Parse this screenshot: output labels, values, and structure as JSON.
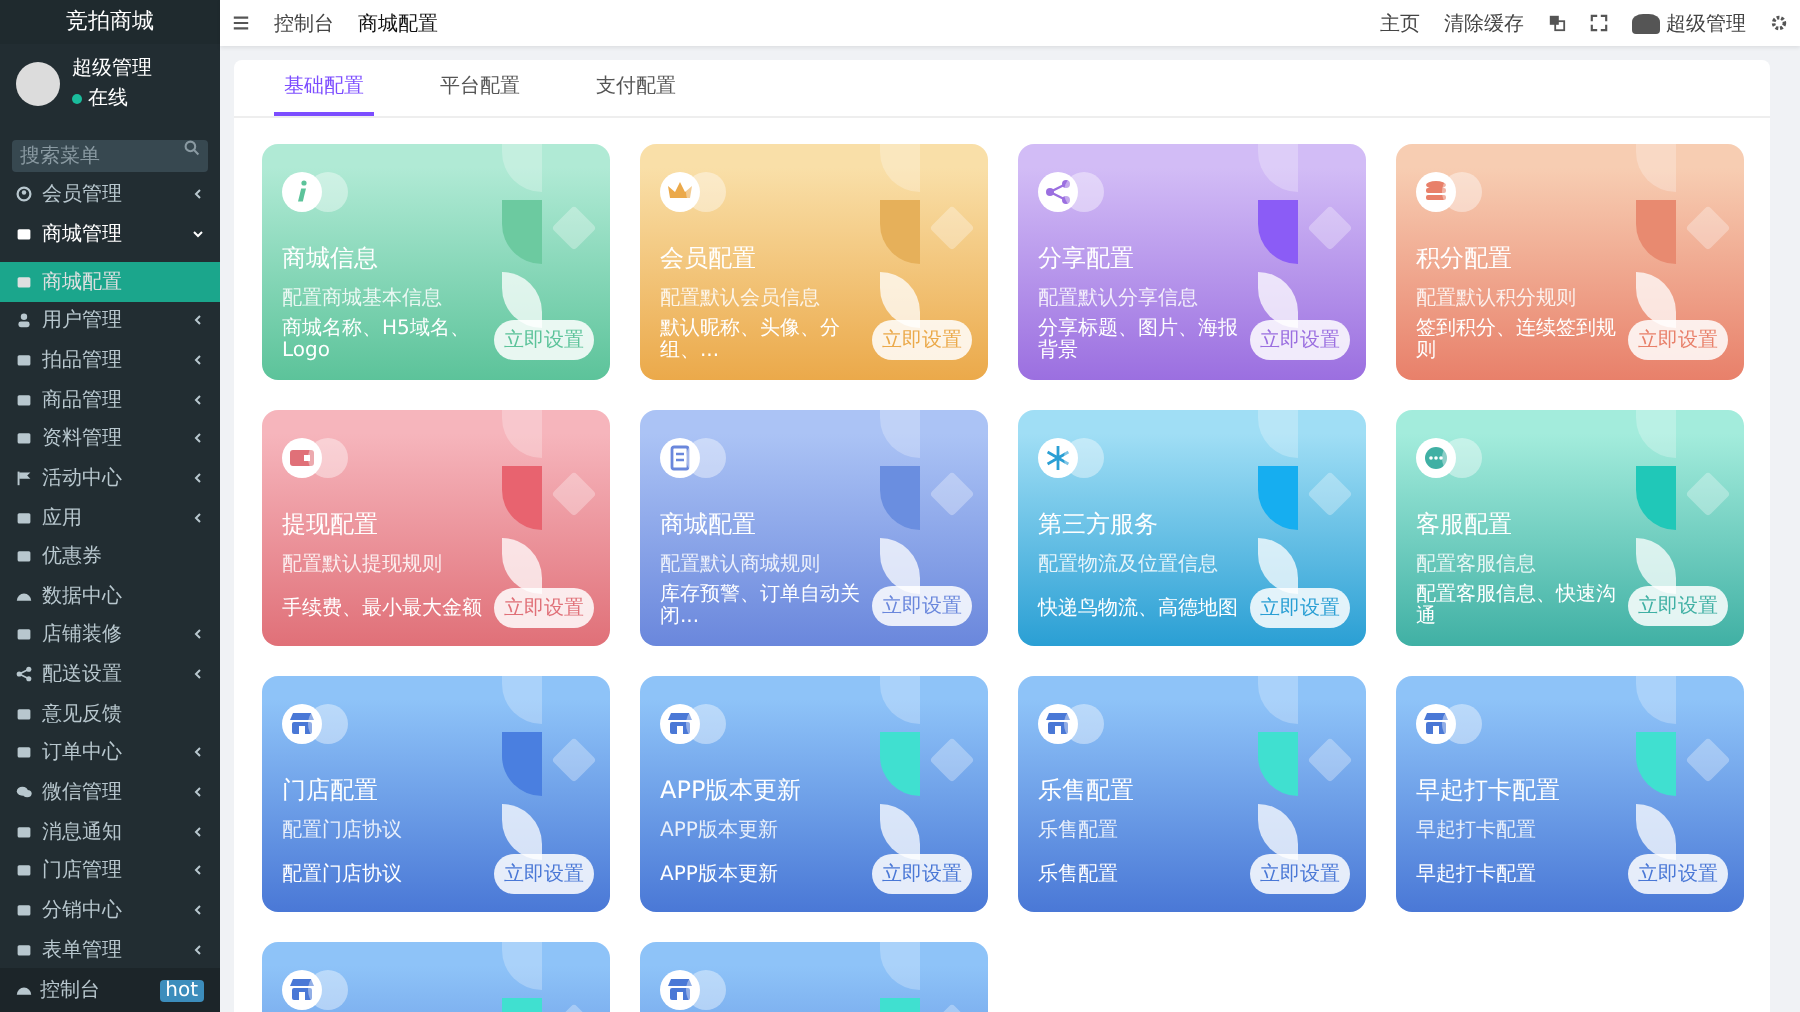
{
  "sidebar": {
    "logo": "竞拍商城",
    "user": {
      "name": "超级管理",
      "status": "在线"
    },
    "search": {
      "placeholder": "搜索菜单"
    },
    "items": [
      {
        "label": "会员管理",
        "kind": "group",
        "expanded": false,
        "selected": false
      },
      {
        "label": "商城管理",
        "kind": "group",
        "expanded": true,
        "selected": false,
        "children": [
          {
            "label": "商城配置",
            "selected": true
          }
        ]
      },
      {
        "label": "用户管理",
        "kind": "group",
        "expanded": false,
        "selected": false
      },
      {
        "label": "拍品管理",
        "kind": "group",
        "expanded": false,
        "selected": false
      },
      {
        "label": "商品管理",
        "kind": "group",
        "expanded": false,
        "selected": false
      },
      {
        "label": "资料管理",
        "kind": "group",
        "expanded": false,
        "selected": false
      },
      {
        "label": "活动中心",
        "kind": "group",
        "expanded": false,
        "selected": false
      },
      {
        "label": "应用",
        "kind": "group",
        "expanded": false,
        "selected": false
      },
      {
        "label": "优惠券",
        "kind": "link",
        "selected": false
      },
      {
        "label": "数据中心",
        "kind": "link",
        "selected": false
      },
      {
        "label": "店铺装修",
        "kind": "group",
        "expanded": false,
        "selected": false
      },
      {
        "label": "配送设置",
        "kind": "group",
        "expanded": false,
        "selected": false
      },
      {
        "label": "意见反馈",
        "kind": "link",
        "selected": false
      },
      {
        "label": "订单中心",
        "kind": "group",
        "expanded": false,
        "selected": false
      },
      {
        "label": "微信管理",
        "kind": "group",
        "expanded": false,
        "selected": false
      },
      {
        "label": "消息通知",
        "kind": "group",
        "expanded": false,
        "selected": false
      },
      {
        "label": "门店管理",
        "kind": "group",
        "expanded": false,
        "selected": false
      },
      {
        "label": "分销中心",
        "kind": "group",
        "expanded": false,
        "selected": false
      },
      {
        "label": "表单管理",
        "kind": "group",
        "expanded": false,
        "selected": false
      },
      {
        "label": "控制台",
        "kind": "footer",
        "badge": "hot",
        "selected": false
      }
    ]
  },
  "topbar": {
    "tabs": [
      {
        "label": "控制台",
        "selected": false
      },
      {
        "label": "商城配置",
        "selected": true
      }
    ],
    "links": [
      "主页",
      "清除缓存"
    ],
    "user": "超级管理"
  },
  "tabs": [
    {
      "label": "基础配置",
      "selected": true
    },
    {
      "label": "平台配置",
      "selected": false
    },
    {
      "label": "支付配置",
      "selected": false
    }
  ],
  "cards": [
    {
      "title": "商城信息",
      "subtitle": "配置商城基本信息",
      "detail": "商城名称、H5域名、Logo",
      "button": "立即设置",
      "color": "#b0ead5"
    },
    {
      "title": "会员配置",
      "subtitle": "配置默认会员信息",
      "detail": "默认昵称、头像、分组、...",
      "button": "立即设置",
      "color": "#f9dfa8"
    },
    {
      "title": "分享配置",
      "subtitle": "配置默认分享信息",
      "detail": "分享标题、图片、海报背景",
      "button": "立即设置",
      "color": "#d2bcf6"
    },
    {
      "title": "积分配置",
      "subtitle": "配置默认积分规则",
      "detail": "签到积分、连续签到规则",
      "button": "立即设置",
      "color": "#f7cdb2"
    },
    {
      "title": "提现配置",
      "subtitle": "配置默认提现规则",
      "detail": "手续费、最小最大金额",
      "button": "立即设置",
      "color": "#f6b5bc"
    },
    {
      "title": "商城配置",
      "subtitle": "配置默认商城规则",
      "detail": "库存预警、订单自动关闭...",
      "button": "立即设置",
      "color": "#abc3f5"
    },
    {
      "title": "第三方服务",
      "subtitle": "配置物流及位置信息",
      "detail": "快递鸟物流、高德地图",
      "button": "立即设置",
      "color": "#a0def5"
    },
    {
      "title": "客服配置",
      "subtitle": "配置客服信息",
      "detail": "配置客服信息、快速沟通",
      "button": "立即设置",
      "color": "#a3ecdc"
    },
    {
      "title": "门店配置",
      "subtitle": "配置门店协议",
      "detail": "配置门店协议",
      "button": "立即设置",
      "color": "#8ec3f8"
    },
    {
      "title": "APP版本更新",
      "subtitle": "APP版本更新",
      "detail": "APP版本更新",
      "button": "立即设置",
      "color": "#8ec3f8"
    },
    {
      "title": "乐售配置",
      "subtitle": "乐售配置",
      "detail": "乐售配置",
      "button": "立即设置",
      "color": "#8ec3f8"
    },
    {
      "title": "早起打卡配置",
      "subtitle": "早起打卡配置",
      "detail": "早起打卡配置",
      "button": "立即设置",
      "color": "#8ec3f8"
    },
    {
      "color": "#8ec3f8"
    },
    {
      "color": "#8ec3f8"
    }
  ]
}
